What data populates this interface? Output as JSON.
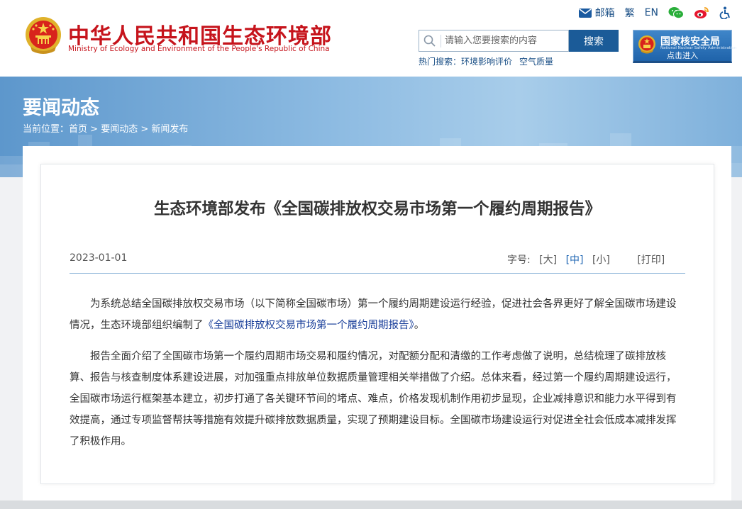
{
  "header": {
    "logo_cn": "中华人民共和国生态环境部",
    "logo_en": "Ministry of Ecology and Environment of the People's Republic of China",
    "toplinks": {
      "mail": "邮箱",
      "traditional": "繁",
      "english": "EN"
    },
    "search": {
      "placeholder": "请输入您要搜索的内容",
      "button": "搜索"
    },
    "hot_search": {
      "label": "热门搜索：",
      "items": [
        "环境影响评价",
        "空气质量"
      ]
    },
    "nnsa": {
      "title": "国家核安全局",
      "subtitle": "National Nuclear Safety Administration",
      "enter": "点击进入"
    }
  },
  "banner": {
    "title": "要闻动态",
    "breadcrumb": {
      "label": "当前位置：",
      "items": [
        "首页",
        "要闻动态",
        "新闻发布"
      ],
      "sep": ">"
    }
  },
  "article": {
    "title": "生态环境部发布《全国碳排放权交易市场第一个履约周期报告》",
    "date": "2023-01-01",
    "font_size": {
      "label": "字号:",
      "large": "[大]",
      "medium": "[中]",
      "small": "[小]",
      "selected": "medium"
    },
    "print": "[打印]",
    "para1_before": "为系统总结全国碳排放权交易市场（以下简称全国碳市场）第一个履约周期建设运行经验，促进社会各界更好了解全国碳市场建设情况，生态环境部组织编制了",
    "para1_link": "《全国碳排放权交易市场第一个履约周期报告》",
    "para1_after": "。",
    "para2": "报告全面介绍了全国碳市场第一个履约周期市场交易和履约情况，对配额分配和清缴的工作考虑做了说明，总结梳理了碳排放核算、报告与核查制度体系建设进展，对加强重点排放单位数据质量管理相关举措做了介绍。总体来看，经过第一个履约周期建设运行，全国碳市场运行框架基本建立，初步打通了各关键环节间的堵点、难点，价格发现机制作用初步显现，企业减排意识和能力水平得到有效提高，通过专项监督帮扶等措施有效提升碳排放数据质量，实现了预期建设目标。全国碳市场建设运行对促进全社会低成本减排发挥了积极作用。"
  },
  "colors": {
    "brand_red": "#c6141c",
    "nav_blue": "#1b5b98",
    "link_blue": "#1a3f9a"
  }
}
